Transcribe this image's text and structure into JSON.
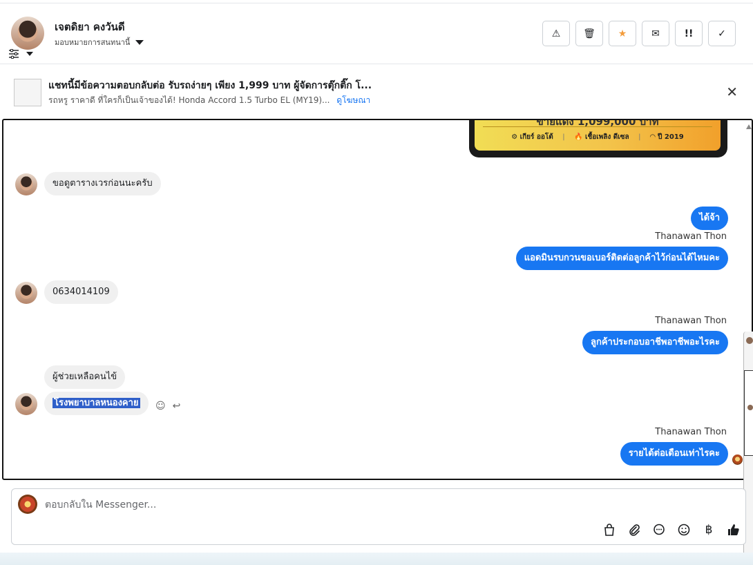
{
  "header": {
    "contact_name": "เจตดิยา คงวันดี",
    "assign_label": "มอบหมายการสนทนานี้",
    "actions": {
      "spam": "⚠",
      "delete": "🗑",
      "star": "★",
      "mail": "✉",
      "important": "!!",
      "done": "✓"
    }
  },
  "ad": {
    "title": "แชทนี้มีข้อความตอบกลับต่อ รับรถง่ายๆ เพียง 1,999 บาท ผู้จัดการตุ๊กติ๊ก โ...",
    "subtitle": "รถหรู ราคาดี ที่ใครก็เป็นเจ้าของได้! Honda Accord 1.5 Turbo EL (MY19)...",
    "link": "ดูโฆษณา",
    "close": "✕"
  },
  "card": {
    "price": "ขายแดง 1,099,000 บาท",
    "gear": "⚙ เกียร์ ออโต้",
    "fuel": "🔥 เชื้อเพลิง ดีเซล",
    "year": "◠ ปี 2019",
    "sep": "|"
  },
  "messages": {
    "m1": "ขอดูตารางเวรก่อนนะครับ",
    "m2": "ได้จ้า",
    "m2_sender": "Thanawan Thon",
    "m3": "แอดมินรบกวนขอเบอร์ติดต่อลูกค้าไว้ก่อนได้ไหมคะ",
    "m4": "0634014109",
    "m5_sender": "Thanawan Thon",
    "m5": "ลูกค้าประกอบอาชีพอาชีพอะไรคะ",
    "m6": "ผู้ช่วยเหลือคนไข้",
    "m7": "โรงพยาบาลหนองคาย",
    "m8_sender": "Thanawan Thon",
    "m8": "รายได้ต่อเดือนเท่าไรคะ"
  },
  "composer": {
    "placeholder": "ตอบกลับใน Messenger..."
  },
  "colors": {
    "accent": "#1877f2",
    "incoming": "#f0f0f0",
    "selection": "#2f5fc9"
  }
}
